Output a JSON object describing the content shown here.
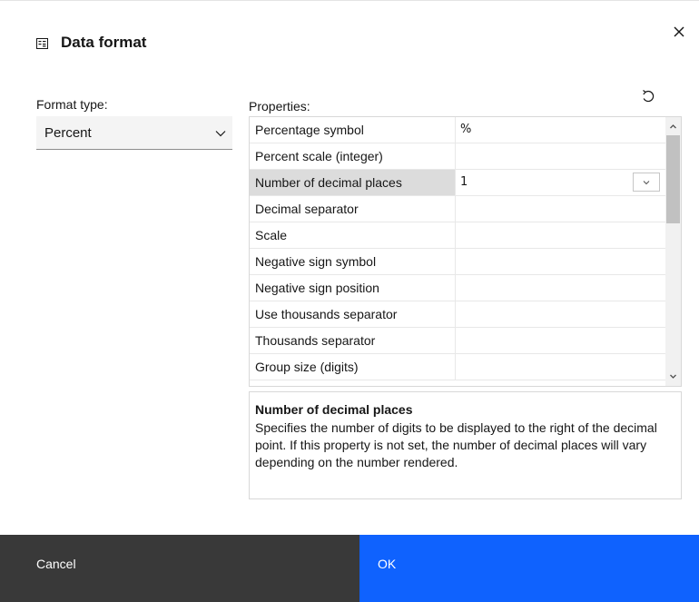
{
  "dialog": {
    "title": "Data format",
    "header_icon": "data-format-icon",
    "close_icon": "close-icon"
  },
  "format_type": {
    "label": "Format type:",
    "selected": "Percent"
  },
  "properties": {
    "label": "Properties:",
    "reset_icon": "reset-icon",
    "rows": [
      {
        "name": "Percentage symbol",
        "value": "%"
      },
      {
        "name": "Percent scale (integer)",
        "value": ""
      },
      {
        "name": "Number of decimal places",
        "value": "1"
      },
      {
        "name": "Decimal separator",
        "value": ""
      },
      {
        "name": "Scale",
        "value": ""
      },
      {
        "name": "Negative sign symbol",
        "value": ""
      },
      {
        "name": "Negative sign position",
        "value": ""
      },
      {
        "name": "Use thousands separator",
        "value": ""
      },
      {
        "name": "Thousands separator",
        "value": ""
      },
      {
        "name": "Group size (digits)",
        "value": ""
      }
    ],
    "selected_index": 2
  },
  "description": {
    "title": "Number of decimal places",
    "text": "Specifies the number of digits to be displayed to the right of the decimal point. If this property is not set, the number of decimal places will vary depending on the number rendered."
  },
  "footer": {
    "cancel_label": "Cancel",
    "ok_label": "OK"
  },
  "colors": {
    "primary": "#0f62fe",
    "secondary": "#393939"
  }
}
